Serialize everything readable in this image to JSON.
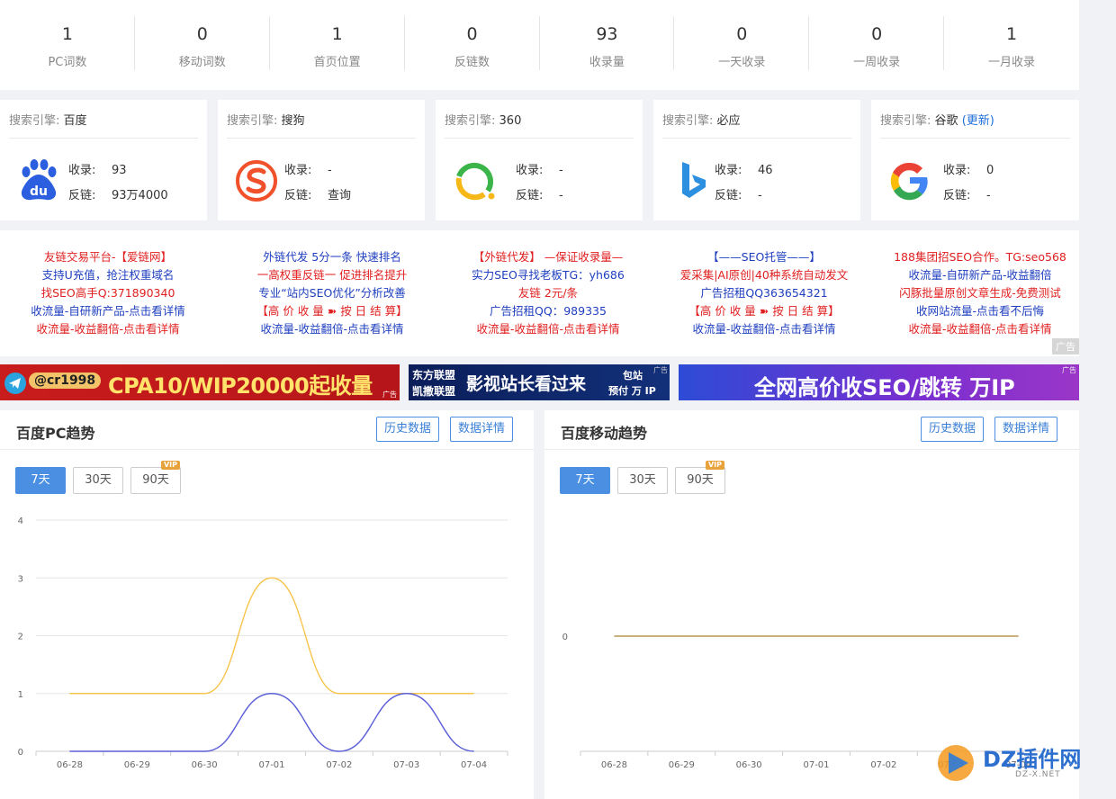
{
  "stats": [
    {
      "value": "1",
      "label": "PC词数"
    },
    {
      "value": "0",
      "label": "移动词数"
    },
    {
      "value": "1",
      "label": "首页位置"
    },
    {
      "value": "0",
      "label": "反链数"
    },
    {
      "value": "93",
      "label": "收录量"
    },
    {
      "value": "0",
      "label": "一天收录"
    },
    {
      "value": "0",
      "label": "一周收录"
    },
    {
      "value": "1",
      "label": "一月收录"
    }
  ],
  "engines": [
    {
      "prefix": "搜索引擎:",
      "name": "百度",
      "update": "",
      "icon": "baidu-icon",
      "index_label": "收录:",
      "index_value": "93",
      "backlink_label": "反链:",
      "backlink_value": "93万4000"
    },
    {
      "prefix": "搜索引擎:",
      "name": "搜狗",
      "update": "",
      "icon": "sogou-icon",
      "index_label": "收录:",
      "index_value": "-",
      "backlink_label": "反链:",
      "backlink_value": "查询"
    },
    {
      "prefix": "搜索引擎:",
      "name": "360",
      "update": "",
      "icon": "so360-icon",
      "index_label": "收录:",
      "index_value": "-",
      "backlink_label": "反链:",
      "backlink_value": "-"
    },
    {
      "prefix": "搜索引擎:",
      "name": "必应",
      "update": "",
      "icon": "bing-icon",
      "index_label": "收录:",
      "index_value": "46",
      "backlink_label": "反链:",
      "backlink_value": "-"
    },
    {
      "prefix": "搜索引擎:",
      "name": "谷歌",
      "update": "(更新)",
      "icon": "google-icon",
      "index_label": "收录:",
      "index_value": "0",
      "backlink_label": "反链:",
      "backlink_value": "-"
    }
  ],
  "ads": {
    "columns": [
      [
        {
          "text": "友链交易平台-【爱链网】",
          "color": "red"
        },
        {
          "text": "支持U充值，抢注权重域名",
          "color": "blue"
        },
        {
          "text": "找SEO高手Q:371890340",
          "color": "red"
        },
        {
          "text": "收流量-自研新产品-点击看详情",
          "color": "blue"
        },
        {
          "text": "收流量-收益翻倍-点击看详情",
          "color": "red"
        }
      ],
      [
        {
          "text": "外链代发 5分一条 快速排名",
          "color": "blue"
        },
        {
          "text": "一高权重反链一 促进排名提升",
          "color": "red"
        },
        {
          "text": "专业“站内SEO优化”分析改善",
          "color": "blue"
        },
        {
          "text": "【高 价 收 量 ➽ 按 日 结 算】",
          "color": "red"
        },
        {
          "text": "收流量-收益翻倍-点击看详情",
          "color": "blue"
        }
      ],
      [
        {
          "text": "【外链代发】 —保证收录量—",
          "color": "red"
        },
        {
          "text": "实力SEO寻找老板TG：yh686",
          "color": "blue"
        },
        {
          "text": "友链 2元/条",
          "color": "red"
        },
        {
          "text": "广告招租QQ：989335",
          "color": "blue"
        },
        {
          "text": "收流量-收益翻倍-点击看详情",
          "color": "red"
        }
      ],
      [
        {
          "text": "【——SEO托管——】",
          "color": "blue"
        },
        {
          "text": "爱采集|AI原创|40种系统自动发文",
          "color": "red"
        },
        {
          "text": "广告招租QQ363654321",
          "color": "blue"
        },
        {
          "text": "【高 价 收 量 ➽ 按 日 结 算】",
          "color": "red"
        },
        {
          "text": "收流量-收益翻倍-点击看详情",
          "color": "blue"
        }
      ],
      [
        {
          "text": "188集团招SEO合作。TG:seo568",
          "color": "red"
        },
        {
          "text": "收流量-自研新产品-收益翻倍",
          "color": "blue"
        },
        {
          "text": "闪豚批量原创文章生成-免费测试",
          "color": "red"
        },
        {
          "text": "收网站流量-点击看不后悔",
          "color": "blue"
        },
        {
          "text": "收流量-收益翻倍-点击看详情",
          "color": "red"
        }
      ]
    ],
    "tag": "广告"
  },
  "banners": {
    "b1": {
      "handle": "@cr1998",
      "text": "CPA10/WIP20000起收量",
      "tag": "广告"
    },
    "b2": {
      "l1": "东方联盟",
      "l2": "凯撒联盟",
      "text": "影视站长看过来",
      "r1": "包站",
      "r2": "预付 万 IP",
      "tag": "广告"
    },
    "b3": {
      "text": "全网高价收SEO/跳转 万IP",
      "tag": "广告"
    }
  },
  "pc_chart": {
    "title": "百度PC趋势",
    "history_btn": "历史数据",
    "detail_btn": "数据详情",
    "ranges": [
      "7天",
      "30天",
      "90天"
    ],
    "active_range": "7天",
    "vip": "VIP"
  },
  "mobile_chart": {
    "title": "百度移动趋势",
    "history_btn": "历史数据",
    "detail_btn": "数据详情",
    "ranges": [
      "7天",
      "30天",
      "90天"
    ],
    "active_range": "7天",
    "vip": "VIP"
  },
  "watermark": {
    "text": "DZ插件网",
    "sub": "DZ-X.NET"
  },
  "chart_data": [
    {
      "type": "line",
      "title": "百度PC趋势",
      "x": [
        "06-28",
        "06-29",
        "06-30",
        "07-01",
        "07-02",
        "07-03",
        "07-04"
      ],
      "ylim": [
        0,
        4
      ],
      "yticks": [
        0,
        1,
        2,
        3,
        4
      ],
      "smooth": true,
      "grid": true,
      "series": [
        {
          "values": [
            1,
            1,
            1,
            3,
            1,
            1,
            1
          ],
          "color": "#f7c44c"
        },
        {
          "values": [
            0,
            0,
            0,
            1,
            0,
            1,
            0
          ],
          "color": "#5b5fd6"
        }
      ]
    },
    {
      "type": "line",
      "title": "百度移动趋势",
      "x": [
        "06-28",
        "06-29",
        "06-30",
        "07-01",
        "07-02",
        "07-03",
        "07-04"
      ],
      "yticks": [
        0
      ],
      "grid": true,
      "series": [
        {
          "values": [
            0,
            0,
            0,
            0,
            0,
            0,
            0
          ],
          "color": "#b89550"
        }
      ]
    }
  ]
}
